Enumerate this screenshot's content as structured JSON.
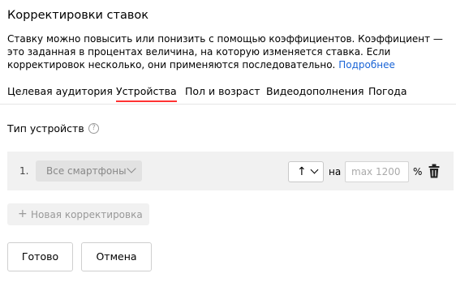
{
  "header": {
    "title": "Корректировки ставок",
    "description": "Ставку можно повысить или понизить с помощью коэффициентов. Коэффициент — это заданная в процентах величина, на которую изменяется ставка. Если корректировок несколько, они применяются последовательно.",
    "more_link": "Подробнее"
  },
  "tabs": [
    {
      "label": "Целевая аудитория",
      "active": false
    },
    {
      "label": "Устройства",
      "active": true
    },
    {
      "label": "Пол и возраст",
      "active": false
    },
    {
      "label": "Видеодополнения",
      "active": false
    },
    {
      "label": "Погода",
      "active": false
    }
  ],
  "section": {
    "title": "Тип устройств",
    "help_icon": "question-circle-icon"
  },
  "adjustment": {
    "index": "1.",
    "device_value": "Все смартфоны",
    "direction_symbol": "↑",
    "on_label": "на",
    "coef_placeholder": "max 1200",
    "coef_value": "",
    "percent_sign": "%",
    "delete_icon": "trash-icon"
  },
  "add_button": {
    "plus": "+",
    "label": "Новая корректировка"
  },
  "footer": {
    "done_label": "Готово",
    "cancel_label": "Отмена"
  },
  "colors": {
    "active_tab_underline": "#ff3333",
    "link": "#1a64d6",
    "row_background": "#f1f1f1"
  }
}
